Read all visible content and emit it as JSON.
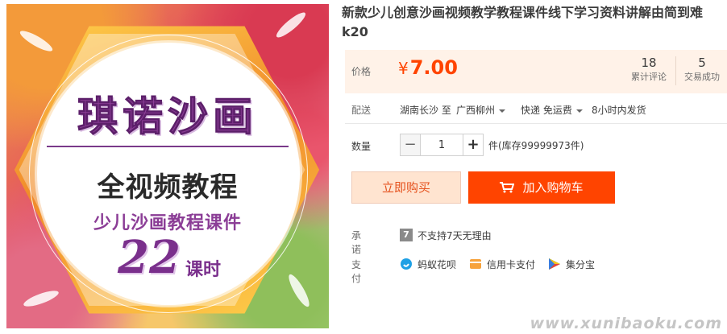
{
  "product": {
    "title": "新款少儿创意沙画视频教学教程课件线下学习资料讲解由简到难k20"
  },
  "image": {
    "brand_text": "琪诺沙画",
    "course_title": "全视频教程",
    "course_subtitle": "少儿沙画教程课件",
    "hours_number": "22",
    "hours_unit": "课时"
  },
  "price": {
    "label": "价格",
    "currency": "¥",
    "amount": "7.00",
    "reviews_count": "18",
    "reviews_label": "累计评论",
    "sales_count": "5",
    "sales_label": "交易成功"
  },
  "delivery": {
    "label": "配送",
    "origin": "湖南长沙 至",
    "destination": "广西柳州",
    "shipping": "快递 免运费",
    "dispatch_time": "8小时内发货"
  },
  "quantity": {
    "label": "数量",
    "minus": "−",
    "value": "1",
    "plus": "+",
    "stock_text": "件(库存99999973件)"
  },
  "actions": {
    "buy_now": "立即购买",
    "add_to_cart": "加入购物车"
  },
  "promise": {
    "label": "承诺",
    "badge": "7",
    "text": "不支持7天无理由"
  },
  "payment": {
    "label": "支付",
    "methods": [
      "蚂蚁花呗",
      "信用卡支付",
      "集分宝"
    ]
  },
  "watermark": "www.xunibaoku.com",
  "colors": {
    "accent": "#ff4400",
    "price": "#ff4400",
    "price_bg": "#fff2e8",
    "buy_now_bg": "#ffe4d0",
    "brand_purple": "#8b3d96"
  }
}
